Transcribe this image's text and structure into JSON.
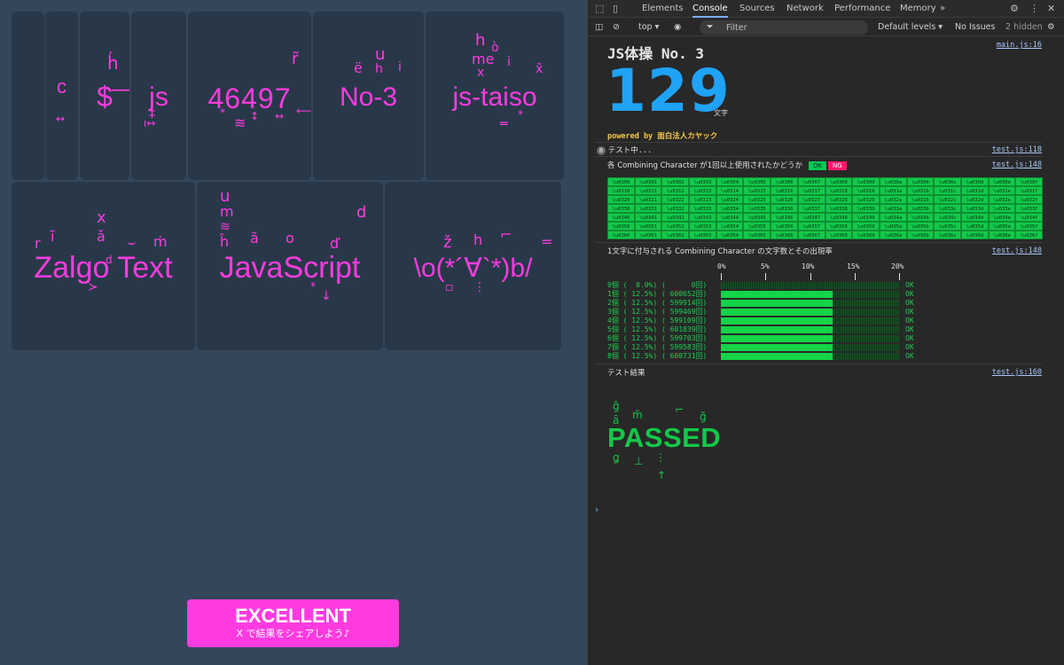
{
  "app": {
    "cards": [
      {
        "text": ""
      },
      {
        "text": "c"
      },
      {
        "text": "$"
      },
      {
        "text": "js"
      },
      {
        "text": "46497"
      },
      {
        "text": "No-3"
      },
      {
        "text": "js-taiso"
      },
      {
        "text": "Zalgo Text"
      },
      {
        "text": "JavaScript"
      },
      {
        "text": "\\o(*´∀`*)b/"
      }
    ],
    "share": {
      "label": "EXCELLENT",
      "sub": "X で結果をシェアしよう♪"
    },
    "colors": {
      "accent": "#ff3be0",
      "background": "#34465a",
      "card": "#283849"
    }
  },
  "devtools": {
    "tabs": [
      "Elements",
      "Console",
      "Sources",
      "Network",
      "Performance",
      "Memory"
    ],
    "active_tab": "Console",
    "more_tabs": "»",
    "toolbar": {
      "context": "top",
      "filter_placeholder": "Filter",
      "levels": "Default levels",
      "issues": "No Issues",
      "hidden": "2 hidden"
    },
    "console": {
      "title": "JS体操 No. 3",
      "count": "129",
      "count_unit": "文字",
      "powered": "powered by 面白法人カヤック",
      "links": {
        "main": "main.js:16",
        "test118": "test.js:118",
        "test148a": "test.js:148",
        "test148b": "test.js:148",
        "test160": "test.js:160"
      },
      "log_count": "8",
      "testing": "テスト中...",
      "check_label": "各 Combining Character が1回以上使用されたかどうか",
      "legend_ok": "OK",
      "legend_ng": "NG",
      "combining_chars": [
        [
          "\\u0300",
          "\\u0301",
          "\\u0302",
          "\\u0303",
          "\\u0304",
          "\\u0305",
          "\\u0306",
          "\\u0307",
          "\\u0308",
          "\\u0309",
          "\\u030a",
          "\\u030b",
          "\\u030c",
          "\\u030d",
          "\\u030e",
          "\\u030f"
        ],
        [
          "\\u0310",
          "\\u0311",
          "\\u0312",
          "\\u0313",
          "\\u0314",
          "\\u0315",
          "\\u0316",
          "\\u0317",
          "\\u0318",
          "\\u0319",
          "\\u031a",
          "\\u031b",
          "\\u031c",
          "\\u031d",
          "\\u031e",
          "\\u031f"
        ],
        [
          "\\u0320",
          "\\u0321",
          "\\u0322",
          "\\u0323",
          "\\u0324",
          "\\u0325",
          "\\u0326",
          "\\u0327",
          "\\u0328",
          "\\u0329",
          "\\u032a",
          "\\u032b",
          "\\u032c",
          "\\u032d",
          "\\u032e",
          "\\u032f"
        ],
        [
          "\\u0330",
          "\\u0331",
          "\\u0332",
          "\\u0333",
          "\\u0334",
          "\\u0335",
          "\\u0336",
          "\\u0337",
          "\\u0338",
          "\\u0339",
          "\\u033a",
          "\\u033b",
          "\\u033c",
          "\\u033d",
          "\\u033e",
          "\\u033f"
        ],
        [
          "\\u0340",
          "\\u0341",
          "\\u0342",
          "\\u0343",
          "\\u0344",
          "\\u0345",
          "\\u0346",
          "\\u0347",
          "\\u0348",
          "\\u0349",
          "\\u034a",
          "\\u034b",
          "\\u034c",
          "\\u034d",
          "\\u034e",
          "\\u034f"
        ],
        [
          "\\u0350",
          "\\u0351",
          "\\u0352",
          "\\u0353",
          "\\u0354",
          "\\u0355",
          "\\u0356",
          "\\u0357",
          "\\u0358",
          "\\u0359",
          "\\u035a",
          "\\u035b",
          "\\u035c",
          "\\u035d",
          "\\u035e",
          "\\u035f"
        ],
        [
          "\\u0360",
          "\\u0361",
          "\\u0362",
          "\\u0363",
          "\\u0364",
          "\\u0365",
          "\\u0366",
          "\\u0367",
          "\\u0368",
          "\\u0369",
          "\\u036a",
          "\\u036b",
          "\\u036c",
          "\\u036d",
          "\\u036e",
          "\\u036f"
        ]
      ],
      "dist_label": "1文字に付与される Combining Character の文字数とその出現率",
      "axis": [
        "0%",
        "5%",
        "10%",
        "15%",
        "20%"
      ],
      "distribution": [
        {
          "label": "0個 (  0.0%) (      0回)",
          "pct": 0.0,
          "status": "OK"
        },
        {
          "label": "1個 ( 12.5%) ( 600652回)",
          "pct": 12.5,
          "status": "OK"
        },
        {
          "label": "2個 ( 12.5%) ( 599914回)",
          "pct": 12.5,
          "status": "OK"
        },
        {
          "label": "3個 ( 12.5%) ( 599469回)",
          "pct": 12.5,
          "status": "OK"
        },
        {
          "label": "4個 ( 12.5%) ( 599109回)",
          "pct": 12.5,
          "status": "OK"
        },
        {
          "label": "5個 ( 12.5%) ( 601839回)",
          "pct": 12.5,
          "status": "OK"
        },
        {
          "label": "6個 ( 12.5%) ( 599703回)",
          "pct": 12.5,
          "status": "OK"
        },
        {
          "label": "7個 ( 12.5%) ( 599583回)",
          "pct": 12.5,
          "status": "OK"
        },
        {
          "label": "8個 ( 12.5%) ( 600731回)",
          "pct": 12.5,
          "status": "OK"
        }
      ],
      "result_label": "テスト結果",
      "result": "PASSED",
      "prompt": "›"
    },
    "colors": {
      "count": "#1fa3f6",
      "powered": "#f8c84a",
      "ok": "#14c84a",
      "ng": "#ff1a6c",
      "link": "#a8c7fa"
    }
  }
}
